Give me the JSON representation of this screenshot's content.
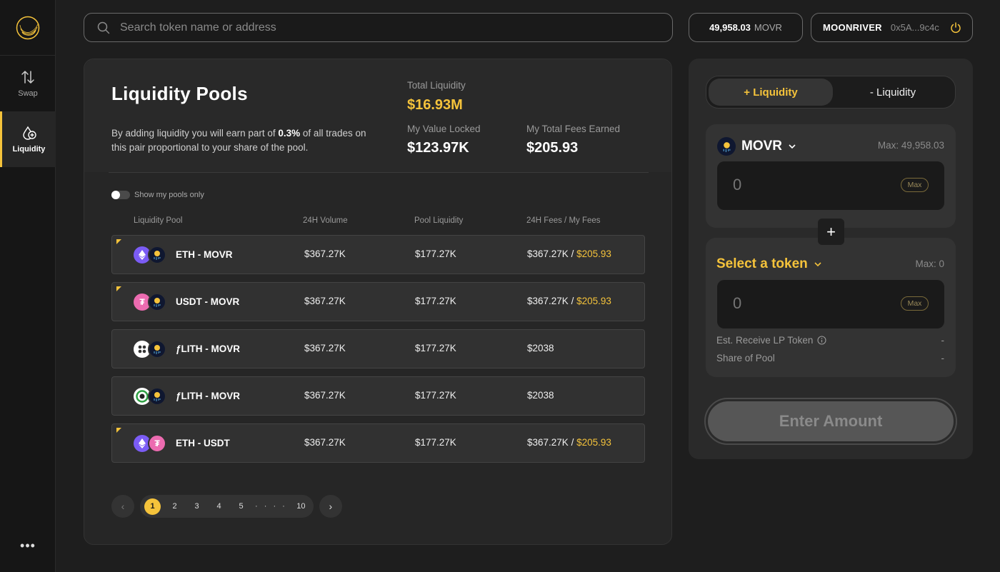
{
  "colors": {
    "accent": "#f5c33b",
    "background": "#1e1e1e",
    "card": "#262626"
  },
  "sidebar": {
    "items": [
      {
        "label": "Swap",
        "icon": "swap-icon"
      },
      {
        "label": "Liquidity",
        "icon": "liquidity-icon",
        "active": true
      }
    ],
    "more": "•••"
  },
  "search": {
    "placeholder": "Search token name or address"
  },
  "balance": {
    "amount": "49,958.03",
    "unit": "MOVR"
  },
  "wallet": {
    "network": "MOONRIVER",
    "address": "0x5A...9c4c"
  },
  "pools": {
    "title": "Liquidity Pools",
    "desc_pre": "By adding liquidity you will earn part of ",
    "desc_pct": "0.3%",
    "desc_post": " of all trades on this pair proportional to your share of the pool.",
    "total_liquidity_label": "Total Liquidity",
    "total_liquidity": "$16.93M",
    "value_locked_label": "My Value Locked",
    "value_locked": "$123.97K",
    "fees_label": "My Total Fees Earned",
    "fees": "$205.93",
    "toggle_label": "Show my pools only",
    "columns": [
      "Liquidity Pool",
      "24H Volume",
      "Pool Liquidity",
      "24H Fees / My Fees"
    ],
    "rows": [
      {
        "name": "ETH - MOVR",
        "volume": "$367.27K",
        "liquidity": "$177.27K",
        "fees": "$367.27K",
        "sep": "/",
        "my_fees": "$205.93"
      },
      {
        "name": "USDT - MOVR",
        "volume": "$367.27K",
        "liquidity": "$177.27K",
        "fees": "$367.27K",
        "sep": "/",
        "my_fees": "$205.93"
      },
      {
        "name": "ƒLITH - MOVR",
        "volume": "$367.27K",
        "liquidity": "$177.27K",
        "fees": "$2038"
      },
      {
        "name": "ƒLITH - MOVR",
        "volume": "$367.27K",
        "liquidity": "$177.27K",
        "fees": "$2038"
      },
      {
        "name": "ETH - USDT",
        "volume": "$367.27K",
        "liquidity": "$177.27K",
        "fees": "$367.27K",
        "sep": "/",
        "my_fees": "$205.93"
      }
    ],
    "pagination": {
      "pages": [
        "1",
        "2",
        "3",
        "4",
        "5"
      ],
      "ellipsis": "· · · ·",
      "last": "10",
      "current": "1"
    }
  },
  "liquidity_panel": {
    "tab_add": "+ Liquidity",
    "tab_remove": "- Liquidity",
    "token1": {
      "symbol": "MOVR",
      "max": "Max: 49,958.03",
      "amount_placeholder": "0",
      "max_btn": "Max"
    },
    "token2": {
      "symbol": "Select a token",
      "max": "Max: 0",
      "amount_placeholder": "0",
      "max_btn": "Max"
    },
    "plus": "+",
    "lp_label": "Est. Receive LP Token",
    "lp_value": "-",
    "share_label": "Share of Pool",
    "share_value": "-",
    "submit": "Enter Amount"
  }
}
